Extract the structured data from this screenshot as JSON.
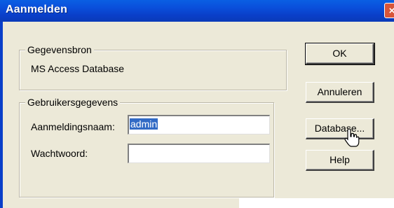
{
  "window": {
    "title": "Aanmelden",
    "close_glyph": "×"
  },
  "data_source": {
    "group_label": "Gegevensbron",
    "value": "MS Access Database"
  },
  "user_data": {
    "group_label": "Gebruikersgegevens",
    "login_label": "Aanmeldingsnaam:",
    "login_value": "admin",
    "password_label": "Wachtwoord:",
    "password_value": ""
  },
  "buttons": {
    "ok": "OK",
    "cancel": "Annuleren",
    "database": "Database...",
    "help": "Help"
  },
  "cursor": {
    "icon": "hand-pointer-icon"
  },
  "colors": {
    "title_bar": "#0a4fdb",
    "face": "#ece9d8",
    "selection": "#316ac5"
  }
}
